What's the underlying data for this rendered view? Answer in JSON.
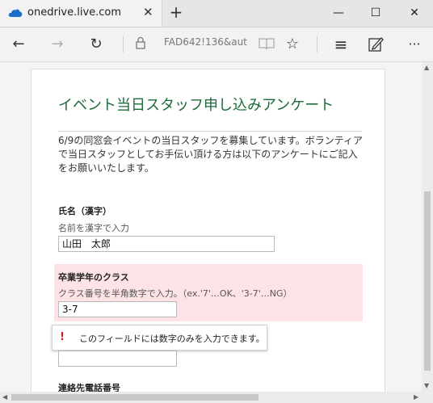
{
  "browser": {
    "tab_title": "onedrive.live.com",
    "address": "FAD642!136&aut",
    "window_controls": {
      "minimize": "—",
      "maximize": "☐",
      "close": "✕"
    },
    "nav_icons": {
      "back": "←",
      "forward": "→",
      "refresh": "↻",
      "lock": "lock-icon",
      "reading_view": "book-icon",
      "favorite": "☆",
      "hub": "≡",
      "note": "pen-icon",
      "more": "···"
    }
  },
  "form": {
    "title": "イベント当日スタッフ申し込みアンケート",
    "description": "6/9の同窓会イベントの当日スタッフを募集しています。ボランティアで当日スタッフとしてお手伝い頂ける方は以下のアンケートにご記入をお願いいたします。",
    "q1": {
      "label": "氏名（漢字）",
      "help": "名前を漢字で入力",
      "value": "山田　太郎"
    },
    "q2": {
      "label": "卒業学年のクラス",
      "help": "クラス番号を半角数字で入力。（ex.'7'…OK、'3-7'…NG）",
      "value": "3-7"
    },
    "q3": {
      "value": ""
    },
    "q4": {
      "label": "連絡先電話番号"
    },
    "error_tooltip": "このフィールドには数字のみを入力できます。"
  },
  "colors": {
    "title_green": "#1e6b3a",
    "error_bg": "#fde3e5",
    "warn_red": "#d21818"
  }
}
